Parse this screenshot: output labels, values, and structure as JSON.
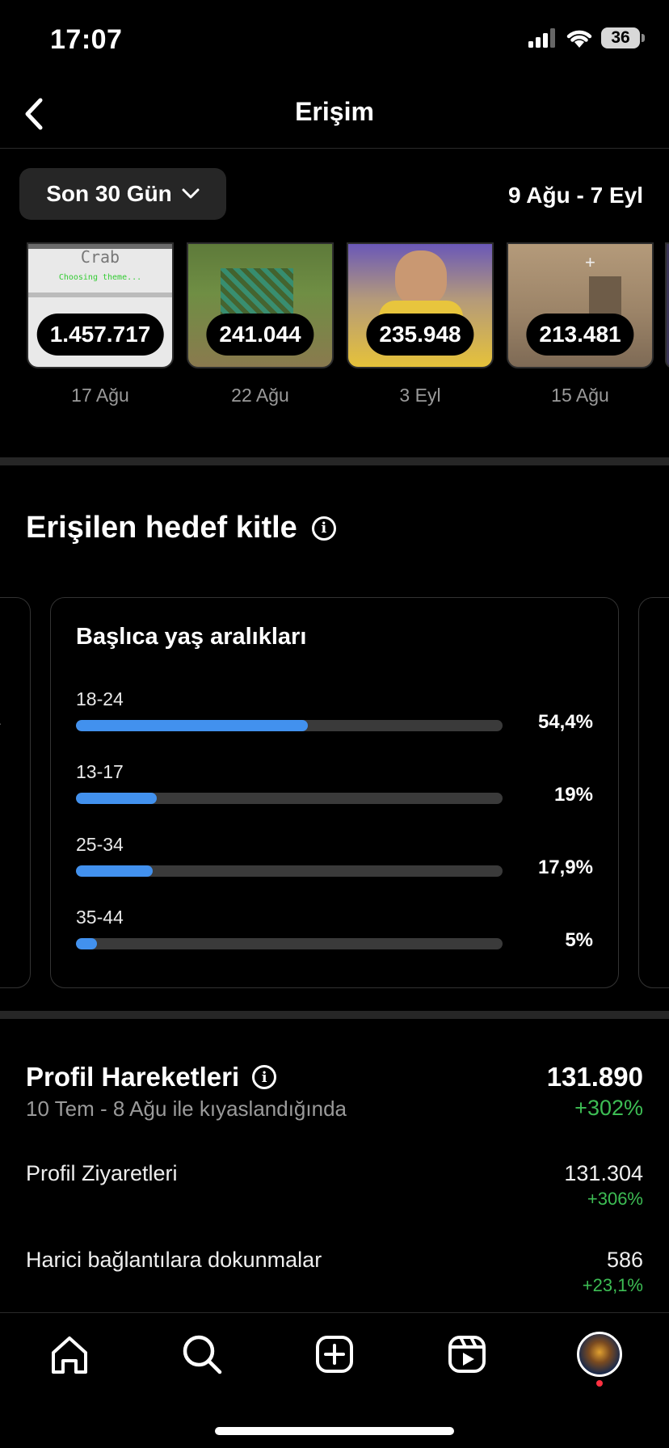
{
  "status": {
    "time": "17:07",
    "battery": "36"
  },
  "header": {
    "title": "Erişim"
  },
  "filter": {
    "range_label": "Son 30 Gün",
    "date_range": "9 Ağu - 7 Eyl"
  },
  "thumbnails": [
    {
      "value": "1.457.717",
      "date": "17 Ağu",
      "caption": "Crab",
      "subcaption": "Choosing theme..."
    },
    {
      "value": "241.044",
      "date": "22 Ağu"
    },
    {
      "value": "235.948",
      "date": "3 Eyl"
    },
    {
      "value": "213.481",
      "date": "15 Ağu"
    }
  ],
  "audience": {
    "title": "Erişilen hedef kitle",
    "card_title": "Başlıca yaş aralıkları",
    "ages": [
      {
        "label": "18-24",
        "pct": "54,4%",
        "fraction": 0.544
      },
      {
        "label": "13-17",
        "pct": "19%",
        "fraction": 0.19
      },
      {
        "label": "25-34",
        "pct": "17,9%",
        "fraction": 0.179
      },
      {
        "label": "35-44",
        "pct": "5%",
        "fraction": 0.05
      }
    ]
  },
  "profile": {
    "title": "Profil Hareketleri",
    "subtitle": "10 Tem - 8 Ağu ile kıyaslandığında",
    "total": "131.890",
    "total_change": "+302%",
    "rows": [
      {
        "label": "Profil Ziyaretleri",
        "value": "131.304",
        "change": "+306%"
      },
      {
        "label": "Harici bağlantılara dokunmalar",
        "value": "586",
        "change": "+23,1%"
      }
    ]
  },
  "colors": {
    "bar": "#4291ee",
    "positive": "#3dbd54",
    "track": "#3a3a3a"
  },
  "tabs": [
    "home-icon",
    "search-icon",
    "create-icon",
    "reels-icon",
    "profile-avatar"
  ]
}
